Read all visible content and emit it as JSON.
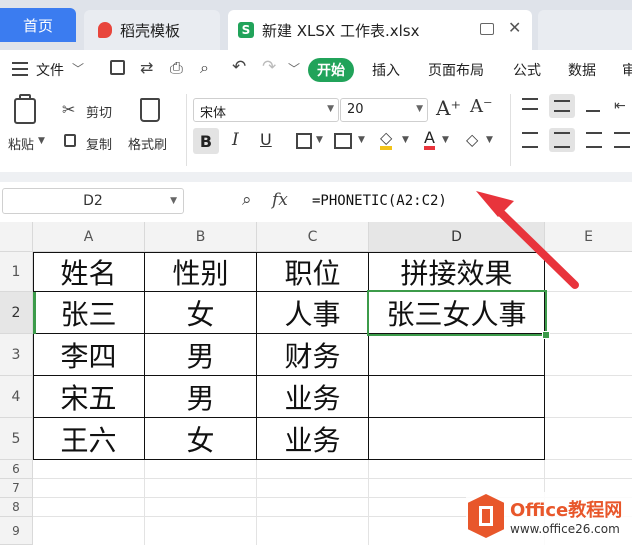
{
  "tabs": {
    "home": "首页",
    "daoke": "稻壳模板",
    "file": "新建 XLSX 工作表.xlsx"
  },
  "menu": {
    "file": "文件",
    "start": "开始",
    "insert": "插入",
    "layout": "页面布局",
    "formula": "公式",
    "data": "数据",
    "more": "审"
  },
  "ribbon": {
    "paste": "粘贴",
    "cut": "剪切",
    "copy": "复制",
    "format_painter": "格式刷",
    "font_name": "宋体",
    "font_size": "20"
  },
  "formula_bar": {
    "cell_ref": "D2",
    "fx": "fx",
    "formula": "=PHONETIC(A2:C2)"
  },
  "sheet": {
    "columns": [
      "A",
      "B",
      "C",
      "D",
      "E"
    ],
    "rows": [
      "1",
      "2",
      "3",
      "4",
      "5",
      "6",
      "7",
      "8",
      "9"
    ],
    "cells": [
      [
        "姓名",
        "性别",
        "职位",
        "拼接效果"
      ],
      [
        "张三",
        "女",
        "人事",
        "张三女人事"
      ],
      [
        "李四",
        "男",
        "财务",
        ""
      ],
      [
        "宋五",
        "男",
        "业务",
        ""
      ],
      [
        "王六",
        "女",
        "业务",
        ""
      ]
    ]
  },
  "watermark": {
    "title": "Office教程网",
    "url": "www.office26.com"
  },
  "colors": {
    "accent_green": "#21a35a",
    "tab_blue": "#3b7cf0",
    "arrow_red": "#e8343c",
    "selection_green": "#3c9b4a"
  }
}
